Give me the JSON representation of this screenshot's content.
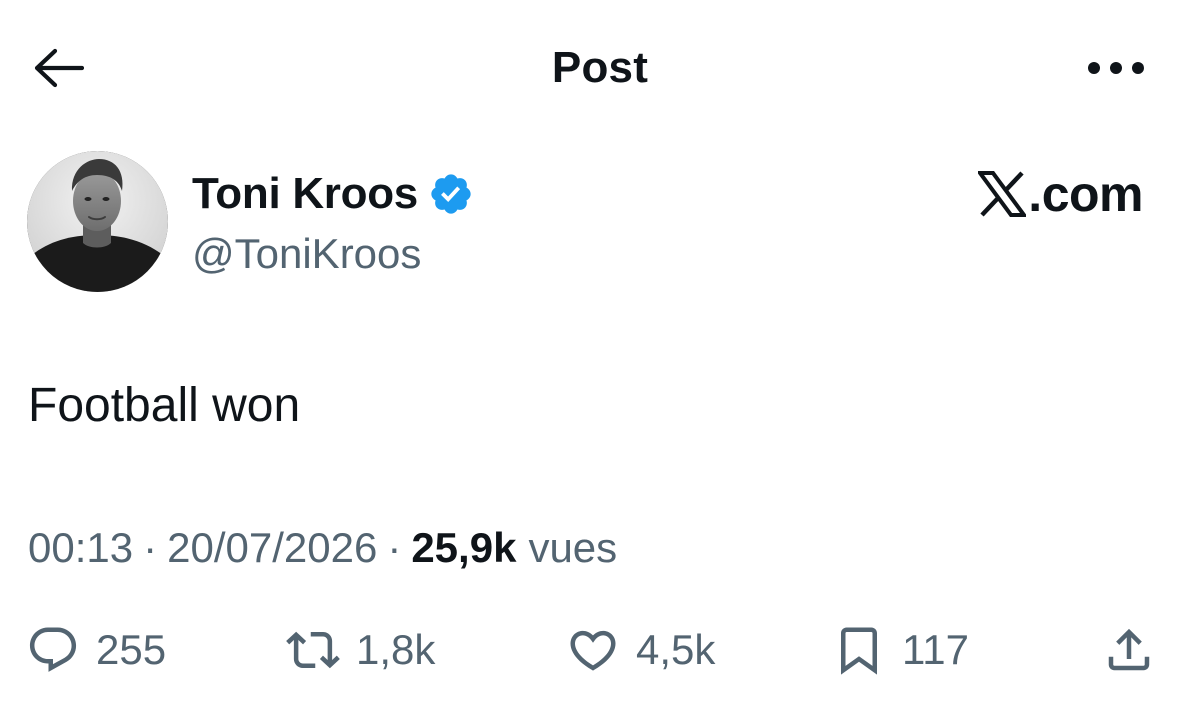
{
  "header": {
    "title": "Post",
    "back_icon": "arrow-left-icon",
    "more_icon": "more-horizontal-icon"
  },
  "author": {
    "name": "Toni Kroos",
    "handle": "@ToniKroos",
    "verified": true,
    "verified_color": "#1d9bf0",
    "avatar_icon": "avatar"
  },
  "brand": {
    "logo_icon": "x-logo-icon",
    "text": ".com"
  },
  "post": {
    "text": "Football won"
  },
  "meta": {
    "time": "00:13",
    "separator": "·",
    "date": "20/07/2026",
    "views_count": "25,9k",
    "views_label": "vues"
  },
  "actions": {
    "reply": {
      "icon": "reply-icon",
      "count": "255"
    },
    "repost": {
      "icon": "repost-icon",
      "count": "1,8k"
    },
    "like": {
      "icon": "heart-icon",
      "count": "4,5k"
    },
    "bookmark": {
      "icon": "bookmark-icon",
      "count": "117"
    },
    "share": {
      "icon": "share-icon"
    }
  },
  "colors": {
    "text_primary": "#0f1419",
    "text_secondary": "#536471",
    "background": "#ffffff",
    "verified": "#1d9bf0"
  }
}
